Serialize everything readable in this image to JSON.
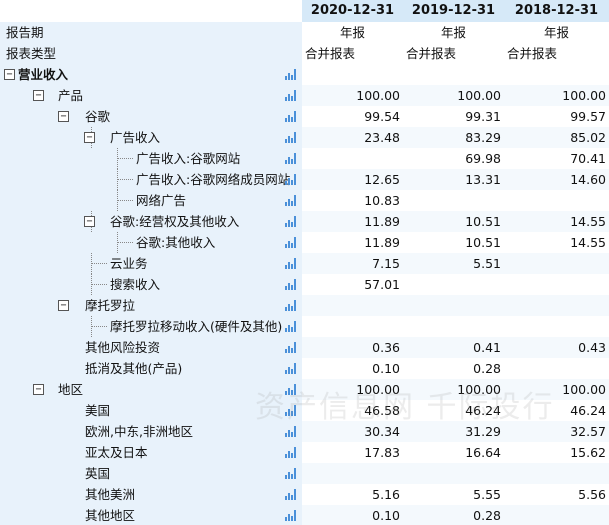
{
  "columns": [
    "2020-12-31",
    "2019-12-31",
    "2018-12-31"
  ],
  "meta_rows": [
    {
      "label": "报告期",
      "values": [
        "年报",
        "年报",
        "年报"
      ],
      "align": "center"
    },
    {
      "label": "报表类型",
      "values": [
        "合并报表",
        "合并报表",
        "合并报表"
      ],
      "align": "left"
    }
  ],
  "rows": [
    {
      "label": "营业收入",
      "level": 0,
      "toggle": "⊟",
      "bold": true,
      "values": [
        "",
        "",
        ""
      ]
    },
    {
      "label": "产品",
      "level": 1,
      "toggle": "⊟",
      "values": [
        "100.00",
        "100.00",
        "100.00"
      ]
    },
    {
      "label": "谷歌",
      "level": 2,
      "toggle": "⊟",
      "values": [
        "99.54",
        "99.31",
        "99.57"
      ]
    },
    {
      "label": "广告收入",
      "level": 3,
      "toggle": "⊟",
      "values": [
        "23.48",
        "83.29",
        "85.02"
      ]
    },
    {
      "label": "广告收入:谷歌网站",
      "level": 4,
      "values": [
        "",
        "69.98",
        "70.41"
      ]
    },
    {
      "label": "广告收入:谷歌网络成员网站",
      "level": 4,
      "values": [
        "12.65",
        "13.31",
        "14.60"
      ]
    },
    {
      "label": "网络广告",
      "level": 4,
      "values": [
        "10.83",
        "",
        ""
      ]
    },
    {
      "label": "谷歌:经营权及其他收入",
      "level": 3,
      "toggle": "⊟",
      "values": [
        "11.89",
        "10.51",
        "14.55"
      ]
    },
    {
      "label": "谷歌:其他收入",
      "level": 4,
      "values": [
        "11.89",
        "10.51",
        "14.55"
      ]
    },
    {
      "label": "云业务",
      "level": 3,
      "values": [
        "7.15",
        "5.51",
        ""
      ]
    },
    {
      "label": "搜索收入",
      "level": 3,
      "values": [
        "57.01",
        "",
        ""
      ]
    },
    {
      "label": "摩托罗拉",
      "level": 2,
      "toggle": "⊟",
      "values": [
        "",
        "",
        ""
      ]
    },
    {
      "label": "摩托罗拉移动收入(硬件及其他)",
      "level": 3,
      "values": [
        "",
        "",
        ""
      ]
    },
    {
      "label": "其他风险投资",
      "level": 2,
      "values": [
        "0.36",
        "0.41",
        "0.43"
      ]
    },
    {
      "label": "抵消及其他(产品)",
      "level": 2,
      "values": [
        "0.10",
        "0.28",
        ""
      ]
    },
    {
      "label": "地区",
      "level": 1,
      "toggle": "⊟",
      "values": [
        "100.00",
        "100.00",
        "100.00"
      ]
    },
    {
      "label": "美国",
      "level": 2,
      "values": [
        "46.58",
        "46.24",
        "46.24"
      ]
    },
    {
      "label": "欧洲,中东,非洲地区",
      "level": 2,
      "values": [
        "30.34",
        "31.29",
        "32.57"
      ]
    },
    {
      "label": "亚太及日本",
      "level": 2,
      "values": [
        "17.83",
        "16.64",
        "15.62"
      ]
    },
    {
      "label": "英国",
      "level": 2,
      "values": [
        "",
        "",
        ""
      ]
    },
    {
      "label": "其他美洲",
      "level": 2,
      "values": [
        "5.16",
        "5.55",
        "5.56"
      ]
    },
    {
      "label": "其他地区",
      "level": 2,
      "values": [
        "0.10",
        "0.28",
        ""
      ]
    }
  ],
  "watermark": "资产信息网 千际投行",
  "colors": {
    "header_bg": "#d6e9f8",
    "label_bg": "#e8f2fb",
    "row_bg": "#ffffff",
    "alt_bg": "#f4f9fd",
    "icon": "#4a90d9"
  },
  "icons": {
    "toggle": "collapse-box-icon",
    "row_icon": "bar-chart-icon"
  }
}
